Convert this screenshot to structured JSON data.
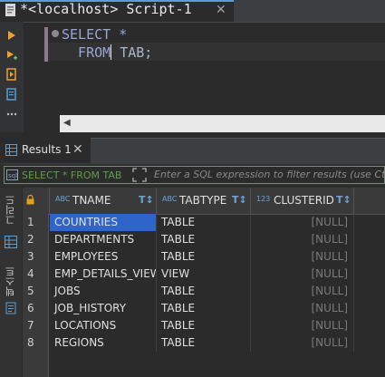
{
  "editor": {
    "tab_title": "*<localhost> Script-1",
    "close_glyph": "✕",
    "code_line1": "SELECT *",
    "code_line2_a": "  FROM",
    "code_line2_b": " TAB;"
  },
  "results": {
    "tab_label": "Results 1",
    "close_glyph": "✕",
    "filter_sql": "SELECT * FROM TAB",
    "filter_placeholder": "Enter a SQL expression to filter results (use Ctrl+"
  },
  "side_rail": {
    "grid_label": "그리드",
    "text_label": "텍스트"
  },
  "grid": {
    "columns": [
      {
        "type": "ABC",
        "label": "TNAME"
      },
      {
        "type": "ABC",
        "label": "TABTYPE"
      },
      {
        "type": "123",
        "label": "CLUSTERID"
      }
    ],
    "rows": [
      {
        "n": "1",
        "tname": "COUNTRIES",
        "tabtype": "TABLE",
        "clusterid": "[NULL]",
        "selected": true
      },
      {
        "n": "2",
        "tname": "DEPARTMENTS",
        "tabtype": "TABLE",
        "clusterid": "[NULL]"
      },
      {
        "n": "3",
        "tname": "EMPLOYEES",
        "tabtype": "TABLE",
        "clusterid": "[NULL]"
      },
      {
        "n": "4",
        "tname": "EMP_DETAILS_VIEW",
        "tabtype": "VIEW",
        "clusterid": "[NULL]"
      },
      {
        "n": "5",
        "tname": "JOBS",
        "tabtype": "TABLE",
        "clusterid": "[NULL]"
      },
      {
        "n": "6",
        "tname": "JOB_HISTORY",
        "tabtype": "TABLE",
        "clusterid": "[NULL]"
      },
      {
        "n": "7",
        "tname": "LOCATIONS",
        "tabtype": "TABLE",
        "clusterid": "[NULL]"
      },
      {
        "n": "8",
        "tname": "REGIONS",
        "tabtype": "TABLE",
        "clusterid": "[NULL]"
      }
    ]
  },
  "colors": {
    "accent": "#2f65ca",
    "run_icon": "#f0a030",
    "null_text": "#7a7a7a",
    "filter_sql": "#5e9c4b"
  }
}
